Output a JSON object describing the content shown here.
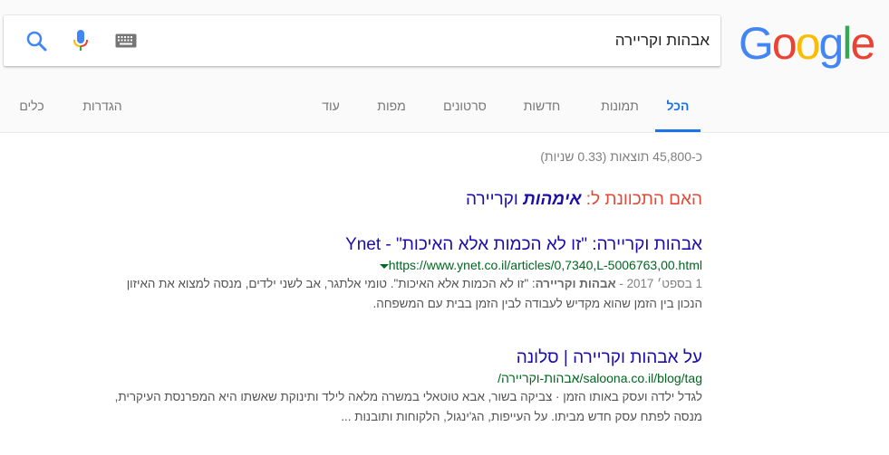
{
  "logo": {
    "letters": [
      "G",
      "o",
      "o",
      "g",
      "l",
      "e"
    ],
    "colors": [
      "#4285f4",
      "#ea4335",
      "#fbbc05",
      "#4285f4",
      "#34a853",
      "#ea4335"
    ]
  },
  "search": {
    "query": "אבהות וקריירה"
  },
  "tabs": [
    {
      "label": "הכל",
      "active": true
    },
    {
      "label": "תמונות",
      "active": false
    },
    {
      "label": "חדשות",
      "active": false
    },
    {
      "label": "סרטונים",
      "active": false
    },
    {
      "label": "מפות",
      "active": false
    },
    {
      "label": "עוד",
      "active": false
    },
    {
      "label": "הגדרות",
      "active": false
    },
    {
      "label": "כלים",
      "active": false
    }
  ],
  "stats": "כ-45,800 תוצאות (0.33 שניות)",
  "did_you_mean": {
    "prefix": "האם התכוונת ל: ",
    "bold_word": "אימהות",
    "rest": " וקריירה"
  },
  "results": [
    {
      "title": "אבהות וקריירה: \"זו לא הכמות אלא האיכות\" - Ynet",
      "url": "https://www.ynet.co.il/articles/0,7340,L-5006763,00.html",
      "date": "1 בספט׳ 2017 - ",
      "snippet_bold": "אבהות וקריירה",
      "snippet_line1_rest": ": \"זו לא הכמות אלא האיכות\". טומי אלתגר, אב לשני ילדים, מנסה למצוא את האיזון",
      "snippet_line2": "הנכון בין הזמן שהוא מקדיש לעבודה לבין הזמן בבית עם המשפחה."
    },
    {
      "title": "על אבהות וקריירה | סלונה",
      "url": "saloona.co.il/blog/tag/אבהות-וקריירה/",
      "snippet_line1": "לגדל ילדה ועסק באותו הזמן · צביקה בשור, אבא טוטאלי במשרה מלאה לילד ותינוקת שאשתו היא המפרנסת העיקרית,",
      "snippet_line2": "מנסה לפתח עסק חדש מביתו. על העייפות, הג'ינגול, הלקוחות ותובנות ..."
    }
  ],
  "icons": {
    "search": "search-icon",
    "mic": "mic-icon",
    "keyboard": "keyboard-icon",
    "caret": "caret-down-icon"
  },
  "colors": {
    "accent": "#1a73e8",
    "link": "#1a0dab",
    "url": "#006621",
    "did_you_mean": "#dd4b39"
  }
}
